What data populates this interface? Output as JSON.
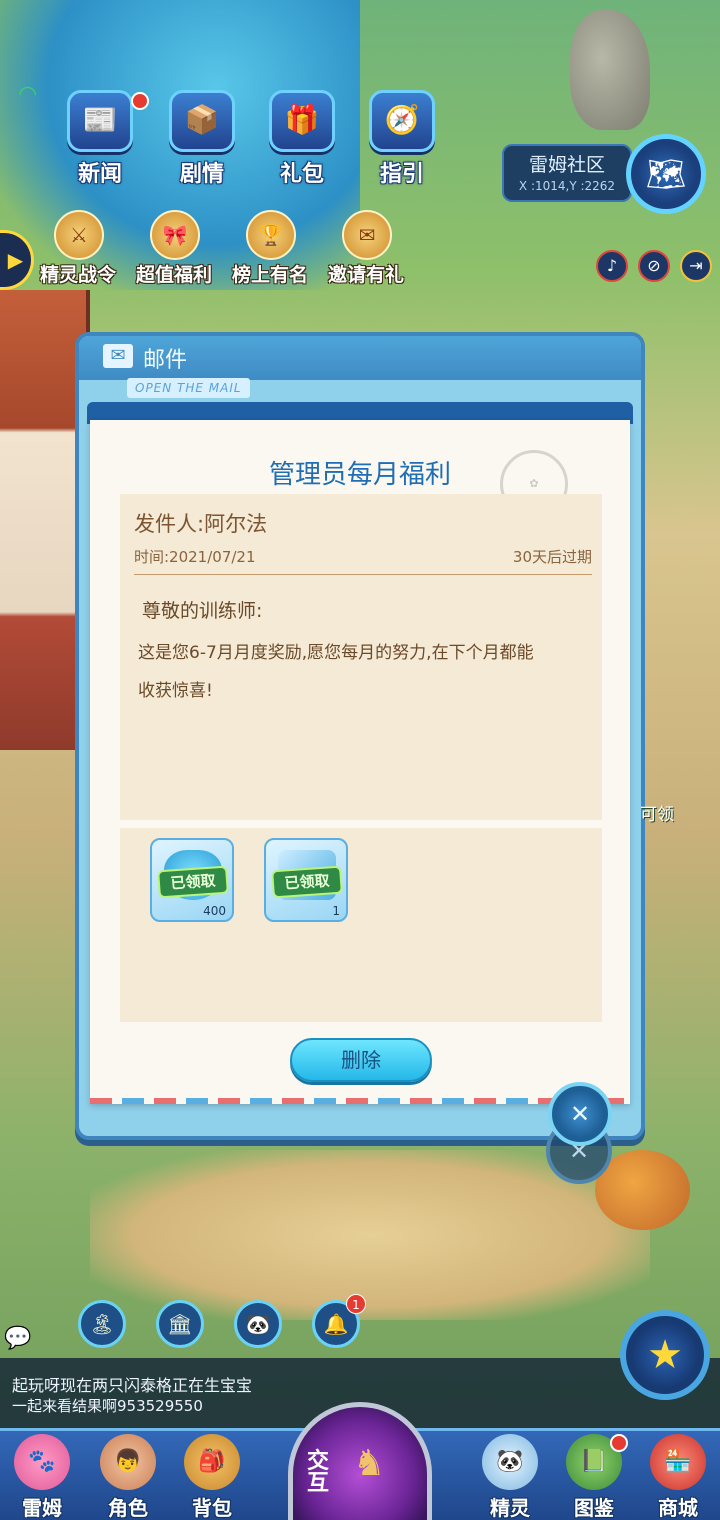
{
  "top_row": [
    {
      "label": "新闻",
      "icon": "news-icon",
      "glyph": "📰"
    },
    {
      "label": "剧情",
      "icon": "story-icon",
      "glyph": "📦"
    },
    {
      "label": "礼包",
      "icon": "gift-pack-icon",
      "glyph": "🎁"
    },
    {
      "label": "指引",
      "icon": "guide-icon",
      "glyph": "🧭"
    }
  ],
  "location": {
    "name": "雷姆社区",
    "coords": "X :1014,Y :2262"
  },
  "second_row": [
    {
      "label": "精灵战令",
      "icon": "battle-pass-icon",
      "glyph": "⚔"
    },
    {
      "label": "超值福利",
      "icon": "welfare-icon",
      "glyph": "🎀"
    },
    {
      "label": "榜上有名",
      "icon": "ranking-trophy-icon",
      "glyph": "🏆"
    },
    {
      "label": "邀请有礼",
      "icon": "invite-icon",
      "glyph": "✉"
    }
  ],
  "mail": {
    "header_title": "邮件",
    "open_tag": "OPEN THE MAIL",
    "title": "管理员每月福利",
    "sender": "发件人:阿尔法",
    "time": "时间:2021/07/21",
    "expire": "30天后过期",
    "greeting": "尊敬的训练师:",
    "message": "这是您6-7月月度奖励,愿您每月的努力,在下个月都能收获惊喜!",
    "rewards": [
      {
        "status": "已领取",
        "quantity": "400",
        "icon": "diamond-icon"
      },
      {
        "status": "已领取",
        "quantity": "1",
        "icon": "ticket-icon"
      }
    ],
    "delete_label": "删除",
    "close_glyph": "✕"
  },
  "claimable_text": "可领",
  "chat": {
    "line1": "起玩呀现在两只闪泰格正在生宝宝",
    "line2": "一起来看结果啊953529550"
  },
  "circle_row": [
    {
      "icon": "island-icon",
      "glyph": "🏝"
    },
    {
      "icon": "guild-icon",
      "glyph": "🏛"
    },
    {
      "icon": "friends-icon",
      "glyph": "🐼"
    },
    {
      "icon": "notification-bell-icon",
      "glyph": "🔔",
      "badge": "1"
    }
  ],
  "nav": [
    {
      "label": "雷姆",
      "icon": "leimu-icon",
      "glyph": "🐾"
    },
    {
      "label": "角色",
      "icon": "character-icon",
      "glyph": "👦"
    },
    {
      "label": "背包",
      "icon": "backpack-icon",
      "glyph": "🎒"
    },
    {
      "label": "精灵",
      "icon": "spirit-icon",
      "glyph": "🐼"
    },
    {
      "label": "图鉴",
      "icon": "handbook-icon",
      "glyph": "📗"
    },
    {
      "label": "商城",
      "icon": "shop-icon",
      "glyph": "🏪"
    }
  ],
  "interact_label": "交互",
  "colors": {
    "accent": "#1f6db4",
    "claimed": "#2f8a45",
    "alert": "#e53b30"
  }
}
